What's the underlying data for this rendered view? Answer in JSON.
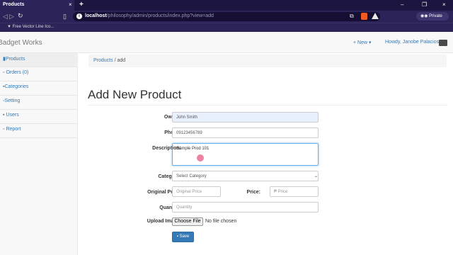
{
  "browser": {
    "tab_title": "Products",
    "tab_close": "×",
    "new_tab": "+",
    "window_controls": [
      "–",
      "❐",
      "×"
    ],
    "url_host": "localhost",
    "url_path": "/philosophy/admin/products/index.php?view=add",
    "bookmark": "Free Vector Line Ico...",
    "private_label": "Private"
  },
  "navbar": {
    "brand": "Badget Works",
    "new_label": "+ New ▾",
    "user_label": "Howdy, Janobe Palacios"
  },
  "sidebar": {
    "items": [
      {
        "label": "Products"
      },
      {
        "label": "Orders (0)"
      },
      {
        "label": "Categories"
      },
      {
        "label": "Setting"
      },
      {
        "label": "Users"
      },
      {
        "label": "Report"
      }
    ]
  },
  "breadcrumb": {
    "link": "Products",
    "current": " / add"
  },
  "page": {
    "title": "Add New Product"
  },
  "form": {
    "owner_label": "Owner:",
    "owner_value": "John Smith",
    "phone_label": "Phone:",
    "phone_value": "09123456789",
    "description_label": "Description:",
    "description_value": "Sample Prod 101",
    "category_label": "Category:",
    "category_value": "Select Category",
    "original_price_label": "Original Price:",
    "original_price_placeholder": "Original Price",
    "price_label": "Price:",
    "price_placeholder": "₱ Price",
    "quantity_label": "Quantity:",
    "quantity_placeholder": "Quantity",
    "upload_label": "Upload Image:",
    "choose_file": "Choose File",
    "no_file": "No file chosen",
    "save_label": "Save"
  }
}
